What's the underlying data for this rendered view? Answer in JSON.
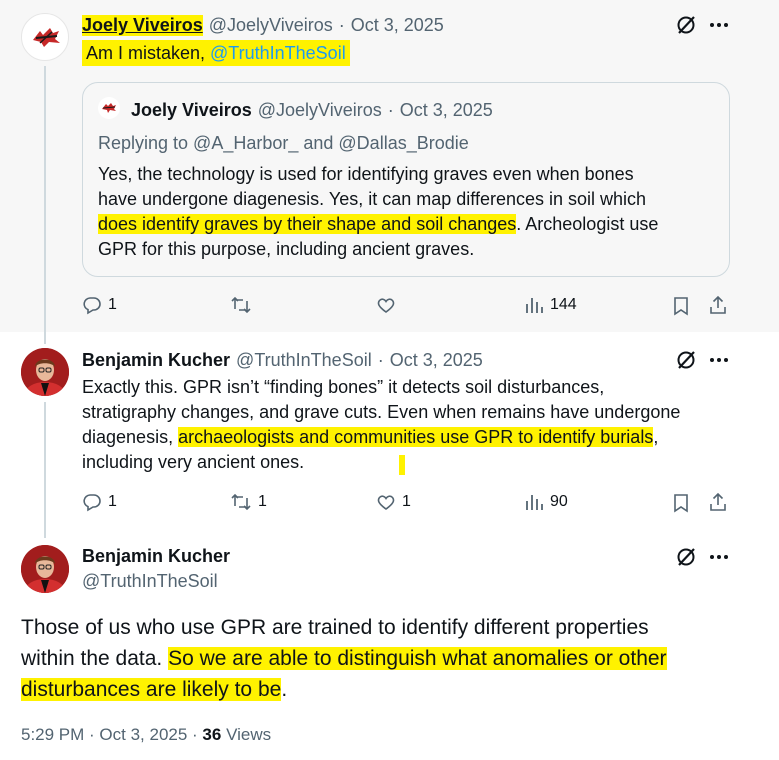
{
  "tweet1": {
    "author_name": "Joely Viveiros",
    "handle": "@JoelyViveiros",
    "dot": "·",
    "date": "Oct 3, 2025",
    "text_prefix": "Am I mistaken, ",
    "mention": "@TruthInTheSoil",
    "quote": {
      "author_name": "Joely Viveiros",
      "handle": "@JoelyViveiros",
      "date": "Oct 3, 2025",
      "replying_to": "Replying to @A_Harbor_ and @Dallas_Brodie",
      "line1": "Yes, the technology is used for identifying graves even when bones",
      "line2": "have undergone diagenesis.  Yes, it can map differences in soil which",
      "line3_hl": "does identify graves by their shape and soil changes",
      "line3_rest": ".  Archeologist use",
      "line4": "GPR for this purpose, including ancient graves."
    },
    "replies": "1",
    "retweets": "",
    "likes": "",
    "views": "144"
  },
  "tweet2": {
    "author_name": "Benjamin Kucher",
    "handle": "@TruthInTheSoil",
    "date": "Oct 3, 2025",
    "line1": "Exactly this. GPR isn’t “finding bones” it detects soil disturbances,",
    "line2": "stratigraphy changes, and grave cuts. Even when remains have undergone",
    "line3_pre": "diagenesis, ",
    "line3_hl": "archaeologists and communities use GPR to identify burials",
    "line3_post": ",",
    "line4": "including very ancient ones.",
    "replies": "1",
    "retweets": "1",
    "likes": "1",
    "views": "90"
  },
  "tweet3": {
    "author_name": "Benjamin Kucher",
    "handle": "@TruthInTheSoil",
    "line1": "Those of us who use GPR are trained to identify different properties",
    "line2_pre": "within the data. ",
    "line2_hl": "So we are able to distinguish what anomalies or other",
    "line3_hl": "disturbances are likely to be",
    "line3_post": ".",
    "time": "5:29 PM · Oct 3, 2025 · ",
    "views_count": "36",
    "views_label": " Views"
  },
  "icons": [
    "grok-icon",
    "more-icon",
    "reply-icon",
    "retweet-icon",
    "like-icon",
    "views-icon",
    "bookmark-icon",
    "share-icon"
  ],
  "colors": {
    "highlight": "#fff200",
    "link": "#1d9bf0",
    "muted": "#536471"
  }
}
